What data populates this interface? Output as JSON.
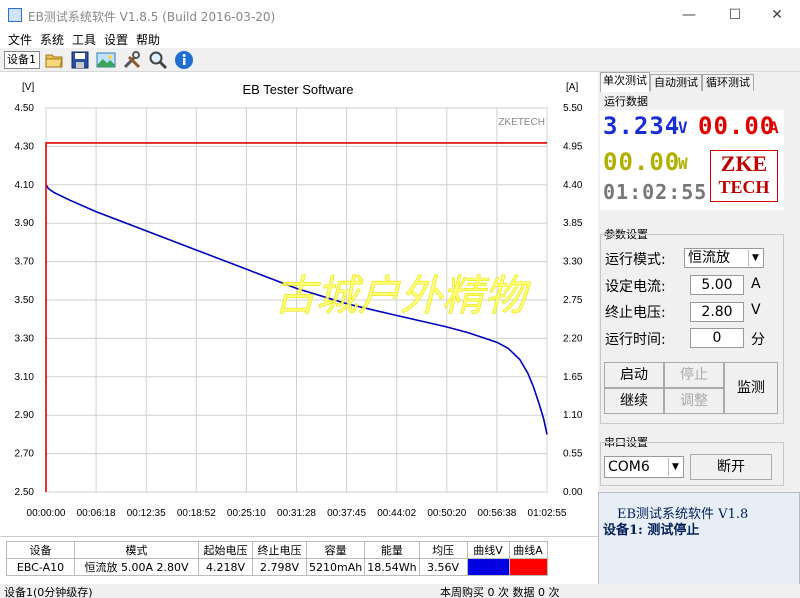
{
  "window": {
    "title": "EB测试系统软件 V1.8.5 (Build 2016-03-20)",
    "minimize": "—",
    "maximize": "☐",
    "close": "✕"
  },
  "menu": [
    "文件",
    "系统",
    "工具",
    "设置",
    "帮助"
  ],
  "toolbar": {
    "device_selected": "设备1",
    "icons": [
      "folder-open-icon",
      "save-icon",
      "image-icon",
      "tools-icon",
      "magnifier-icon",
      "info-icon"
    ]
  },
  "chart_data": {
    "type": "line",
    "title": "EB Tester Software",
    "watermark_brand": "ZKETECH",
    "watermark_text": "古城户外精物",
    "y_left_label": "[V]",
    "y_right_label": "[A]",
    "y_left_ticks": [
      "4.50",
      "4.30",
      "4.10",
      "3.90",
      "3.70",
      "3.50",
      "3.30",
      "3.10",
      "2.90",
      "2.70",
      "2.50"
    ],
    "y_right_ticks": [
      "5.50",
      "4.95",
      "4.40",
      "3.85",
      "3.30",
      "2.75",
      "2.20",
      "1.65",
      "1.10",
      "0.55",
      "0.00"
    ],
    "x_ticks": [
      "00:00:00",
      "00:06:18",
      "00:12:35",
      "00:18:52",
      "00:25:10",
      "00:31:28",
      "00:37:45",
      "00:44:02",
      "00:50:20",
      "00:56:38",
      "01:02:55"
    ],
    "ylim_left": [
      2.5,
      4.5
    ],
    "ylim_right": [
      0,
      5.5
    ],
    "xlim_minutes": [
      0,
      62.92
    ],
    "grid": true,
    "series": [
      {
        "name": "曲线V",
        "color": "#0000c0",
        "axis": "left",
        "x_minutes": [
          0,
          0.3,
          1,
          3,
          6.3,
          12.6,
          18.9,
          25.2,
          31.5,
          37.8,
          44,
          50.3,
          53,
          56.6,
          58,
          59.5,
          60.5,
          61.2,
          62,
          62.5,
          62.92
        ],
        "y": [
          4.1,
          4.08,
          4.06,
          4.02,
          3.96,
          3.86,
          3.76,
          3.66,
          3.56,
          3.48,
          3.42,
          3.36,
          3.33,
          3.28,
          3.25,
          3.19,
          3.12,
          3.05,
          2.95,
          2.88,
          2.8
        ]
      },
      {
        "name": "曲线A",
        "color": "#e00000",
        "axis": "right",
        "x_minutes": [
          0,
          0,
          0.1,
          62.92
        ],
        "y": [
          0,
          5.0,
          5.0,
          5.0
        ]
      }
    ]
  },
  "tabs": [
    "单次测试",
    "自动测试",
    "循环测试"
  ],
  "run_data": {
    "group_label": "运行数据",
    "voltage": "3.234",
    "voltage_unit": "V",
    "current": "00.00",
    "current_unit": "A",
    "power": "00.00",
    "power_unit": "W",
    "time": "01:02:55",
    "logo_line1": "ZKE",
    "logo_line2": "TECH",
    "colors": {
      "voltage": "#1a2ed8",
      "current": "#e00000",
      "power": "#b0b000",
      "time": "#777777"
    }
  },
  "params": {
    "group_label": "参数设置",
    "mode_label": "运行模式:",
    "mode_value": "恒流放",
    "current_label": "设定电流:",
    "current_value": "5.00",
    "current_unit": "A",
    "cutoff_label": "终止电压:",
    "cutoff_value": "2.80",
    "cutoff_unit": "V",
    "time_label": "运行时间:",
    "time_value": "0",
    "time_unit": "分",
    "buttons": {
      "start": "启动",
      "stop": "停止",
      "continue": "继续",
      "adjust": "调整",
      "monitor": "监测"
    }
  },
  "serial": {
    "group_label": "串口设置",
    "port": "COM6",
    "open_button": "断开"
  },
  "status_panel": {
    "line1": "EB测试系统软件 V1.8",
    "line2": "设备1: 测试停止"
  },
  "table": {
    "headers": [
      "设备",
      "模式",
      "起始电压",
      "终止电压",
      "容量",
      "能量",
      "均压",
      "曲线V",
      "曲线A"
    ],
    "row": [
      "EBC-A10",
      "恒流放 5.00A 2.80V",
      "4.218V",
      "2.798V",
      "5210mAh",
      "18.54Wh",
      "3.56V",
      "",
      ""
    ],
    "swatch_colors": [
      "#0000e0",
      "#ff0000"
    ]
  },
  "statusbar": {
    "left": "设备1(0分钟级存)",
    "right": "本周购买 0 次 数据 0 次"
  }
}
